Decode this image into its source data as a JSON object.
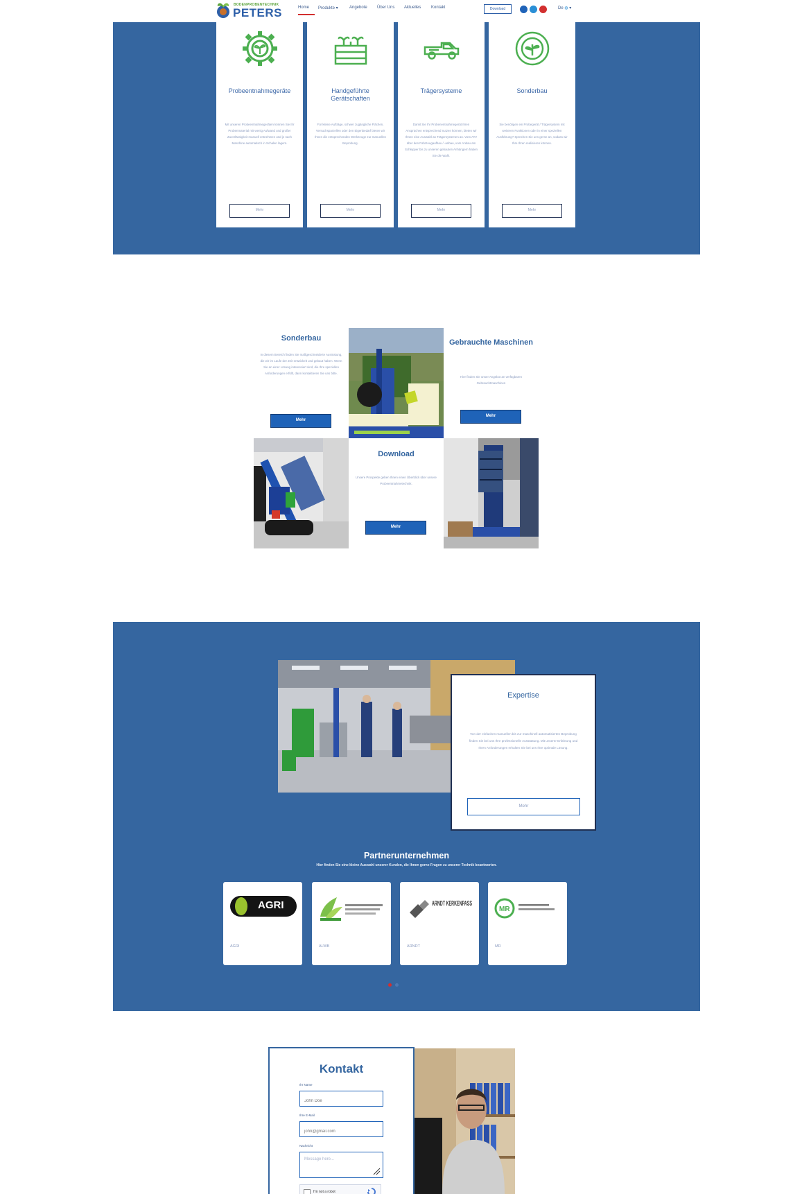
{
  "header": {
    "logo_small": "BODENPROBENTECHNIK",
    "logo_big": "PETERS",
    "nav": [
      "Home",
      "Produkte",
      "Angebote",
      "Über Uns",
      "Aktuelles",
      "Kontakt"
    ],
    "download_label": "Download",
    "language": "De"
  },
  "colors": {
    "band_blue": "#3566a0",
    "button_blue": "#1f63b8",
    "accent_green": "#4caf50",
    "nav_active_red": "#d22f2f"
  },
  "services": [
    {
      "icon": "gear-sprout-icon",
      "title": "Probeentnahmegeräte",
      "text": "Mit unseren Probeentnahmegeräten können Sie Ihr Probenmaterial mit wenig Aufwand und großer Zuverlässigkeit manuell entnehmen und je nach Maschine automatisch in Schalen lagern.",
      "button": "Mehr"
    },
    {
      "icon": "plant-crate-icon",
      "title": "Handgeführte Gerätschaften",
      "text": "Für kleine Aufträge, schwer zugängliche Flächen, Versuchsparzellen oder den Eigenbedarf bieten wir Ihnen die entsprechenden Werkzeuge zur manuellen Beprobung.",
      "button": "Mehr"
    },
    {
      "icon": "pickup-truck-icon",
      "title": "Trägersysteme",
      "text": "Damit Sie Ihr Probenentnahmegerät Ihren Ansprüchen entsprechend nutzen können, bieten wir Ihnen eine Auswahl an Trägersystemen an. Vom ATV über den Fahrzeugaufbau / -anbau, vom Anbau am Schlepper bis zu unseren gebauten Anhängern haben Sie die Wahl.",
      "button": "Mehr"
    },
    {
      "icon": "target-leaf-icon",
      "title": "Sonderbau",
      "text": "Sie benötigen ein Probegerät / Trägersystem mit weiteren Funktionen oder in einer speziellen Ausführung? Sprechen Sie uns gerne an, sodass wir Ihre Ihren realisieren können.",
      "button": "Mehr"
    }
  ],
  "mosaic": {
    "sonderbau": {
      "title": "Sonderbau",
      "text": "In diesem Bereich finden Sie maßgeschneiderte Ausrüstung, die wir im Laufe der Zeit entwickelt und gebaut haben. Wenn Sie an einer Lösung interessiert sind, die Ihre speziellen Anforderungen erfüllt, dann kontaktieren Sie uns bitte.",
      "button": "Mehr"
    },
    "gebrauchte": {
      "title": "Gebrauchte Maschinen",
      "text": "Hier finden Sie unser Angebot an verfügbaren Gebrauchtmaschinen",
      "button": "Mehr"
    },
    "download": {
      "title": "Download",
      "text": "Unsere Prospekte geben Ihnen einen Überblick über unsere Probeentnahmetechnik.",
      "button": "Mehr"
    }
  },
  "expertise": {
    "title": "Expertise",
    "text": "Von der einfachen manuellen bis zur maschinell automatisierten Beprobung finden Sie bei uns Ihre professionelle Ausstattung. Mit unserer Erfahrung und Ihren Anforderungen erhalten Sie bei uns Ihre optimale Lösung.",
    "button": "Mehr"
  },
  "partners": {
    "heading": "Partnerunternehmen",
    "subheading": "Hier finden Sie eine kleine Auswahl unserer Kunden, die Ihnen gerne Fragen zu unserer Technik beantworten.",
    "items": [
      {
        "name": "AGRI",
        "logo_text": "AGRI"
      },
      {
        "name": "ALWB",
        "logo_text": ""
      },
      {
        "name": "ARNDT",
        "logo_text": "ARNDT KERKENPASS"
      },
      {
        "name": "MR",
        "logo_text": "MR"
      }
    ],
    "active_dot": 0
  },
  "contact": {
    "heading": "Kontakt",
    "fields": [
      {
        "label": "Ihr Name",
        "placeholder": "John Doe"
      },
      {
        "label": "Ihre E-Mail",
        "placeholder": "john@gmail.com"
      },
      {
        "label": "Nachricht",
        "placeholder": "Message here..."
      }
    ],
    "captcha_label": "I'm not a robot"
  }
}
